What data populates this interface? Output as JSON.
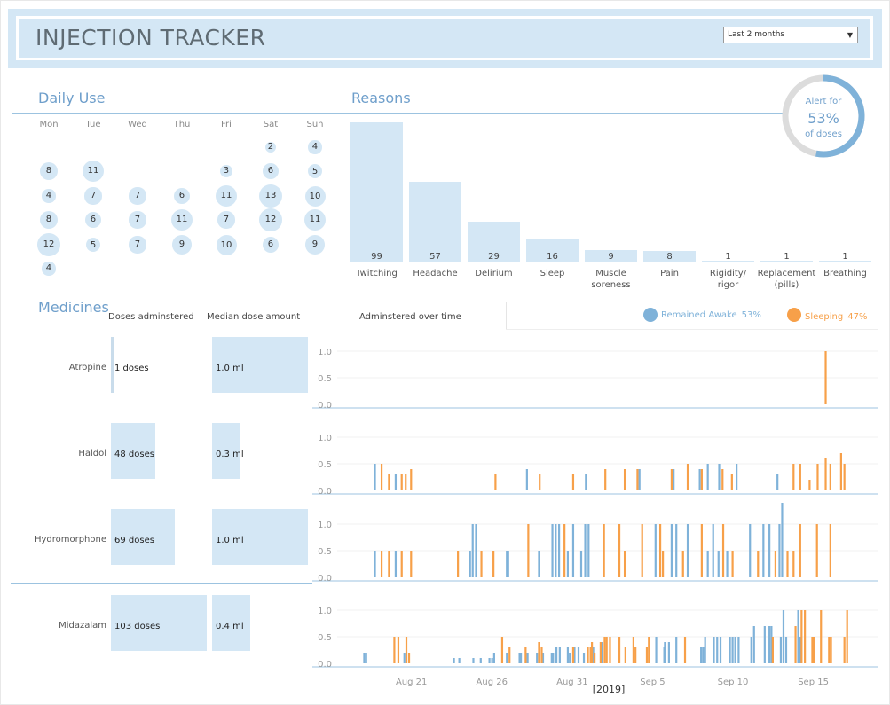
{
  "header": {
    "title": "INJECTION TRACKER",
    "date_filter": "Last 2 months"
  },
  "daily_use": {
    "title": "Daily Use",
    "days": [
      "Mon",
      "Tue",
      "Wed",
      "Thu",
      "Fri",
      "Sat",
      "Sun"
    ],
    "weeks": [
      [
        null,
        null,
        null,
        null,
        null,
        2,
        4
      ],
      [
        8,
        11,
        null,
        null,
        3,
        6,
        5
      ],
      [
        4,
        7,
        7,
        6,
        11,
        13,
        10
      ],
      [
        8,
        6,
        7,
        11,
        7,
        12,
        11
      ],
      [
        12,
        5,
        7,
        9,
        10,
        6,
        9
      ],
      [
        4,
        null,
        null,
        null,
        null,
        null,
        null
      ]
    ]
  },
  "reasons": {
    "title": "Reasons",
    "items": [
      {
        "label": "Twitching",
        "value": 99
      },
      {
        "label": "Headache",
        "value": 57
      },
      {
        "label": "Delirium",
        "value": 29
      },
      {
        "label": "Sleep",
        "value": 16
      },
      {
        "label": "Muscle soreness",
        "value": 9
      },
      {
        "label": "Pain",
        "value": 8
      },
      {
        "label": "Rigidity/ rigor",
        "value": 1
      },
      {
        "label": "Replacement (pills)",
        "value": 1
      },
      {
        "label": "Breathing",
        "value": 1
      }
    ]
  },
  "alert": {
    "line1": "Alert for",
    "value": "53%",
    "line2": "of doses",
    "fraction": 0.53,
    "colors": {
      "fill": "#7fb2d9",
      "rest": "#dcdcdc"
    }
  },
  "medicines": {
    "title": "Medicines",
    "col_doses": "Doses adminstered",
    "col_median": "Median dose amount",
    "col_time": "Adminstered over time",
    "legend": [
      {
        "label": "Remained Awake",
        "pct": "53%",
        "color": "#7fb2d9"
      },
      {
        "label": "Sleeping",
        "pct": "47%",
        "color": "#f7a049"
      }
    ],
    "rows": [
      {
        "name": "Atropine",
        "doses": 1,
        "doses_label": "1 doses",
        "median": 1.0,
        "median_label": "1.0 ml"
      },
      {
        "name": "Haldol",
        "doses": 48,
        "doses_label": "48 doses",
        "median": 0.3,
        "median_label": "0.3 ml"
      },
      {
        "name": "Hydromorphone",
        "doses": 69,
        "doses_label": "69 doses",
        "median": 1.0,
        "median_label": "1.0 ml"
      },
      {
        "name": "Midazalam",
        "doses": 103,
        "doses_label": "103 doses",
        "median": 0.4,
        "median_label": "0.4 ml"
      }
    ]
  },
  "chart_data": {
    "type": "bar",
    "xlabel": "[2019]",
    "xlim": [
      "2019-08-15T00",
      "2019-09-18T12"
    ],
    "x_ticks": [
      {
        "date": "2019-08-21",
        "label": "Aug 21"
      },
      {
        "date": "2019-08-26",
        "label": "Aug 26"
      },
      {
        "date": "2019-08-31",
        "label": "Aug 31"
      },
      {
        "date": "2019-09-05",
        "label": "Sep 5"
      },
      {
        "date": "2019-09-10",
        "label": "Sep 10"
      },
      {
        "date": "2019-09-15",
        "label": "Sep 15"
      }
    ],
    "y_ticks": [
      "1.0",
      "0.5",
      "0.0"
    ],
    "ylim": [
      0,
      1
    ],
    "panels": [
      {
        "name": "Atropine",
        "awake": [],
        "sleeping": [
          [
            "2019-09-15T17",
            1.0
          ]
        ]
      },
      {
        "name": "Haldol",
        "awake": [
          [
            "2019-08-18T16",
            0.5
          ],
          [
            "2019-08-19T23",
            0.3
          ],
          [
            "2019-08-28T03",
            0.4
          ],
          [
            "2019-08-31T19",
            0.3
          ],
          [
            "2019-09-04T03",
            0.4
          ],
          [
            "2019-09-06T06",
            0.4
          ],
          [
            "2019-09-07T21",
            0.4
          ],
          [
            "2019-09-08T09",
            0.5
          ],
          [
            "2019-09-09T02",
            0.5
          ],
          [
            "2019-09-10T04",
            0.5
          ],
          [
            "2019-09-12T17",
            0.3
          ]
        ],
        "sleeping": [
          [
            "2019-08-19T02",
            0.5
          ],
          [
            "2019-08-19T13",
            0.3
          ],
          [
            "2019-08-20T08",
            0.3
          ],
          [
            "2019-08-20T14",
            0.3
          ],
          [
            "2019-08-20T22",
            0.4
          ],
          [
            "2019-08-26T04",
            0.3
          ],
          [
            "2019-08-28T22",
            0.3
          ],
          [
            "2019-08-31T00",
            0.3
          ],
          [
            "2019-09-02T00",
            0.4
          ],
          [
            "2019-09-03T05",
            0.4
          ],
          [
            "2019-09-04T00",
            0.4
          ],
          [
            "2019-09-06T03",
            0.4
          ],
          [
            "2019-09-07T03",
            0.5
          ],
          [
            "2019-09-08T00",
            0.4
          ],
          [
            "2019-09-09T07",
            0.4
          ],
          [
            "2019-09-09T21",
            0.3
          ],
          [
            "2019-09-13T17",
            0.5
          ],
          [
            "2019-09-14T03",
            0.5
          ],
          [
            "2019-09-14T17",
            0.2
          ],
          [
            "2019-09-15T05",
            0.5
          ],
          [
            "2019-09-15T17",
            0.6
          ],
          [
            "2019-09-16T00",
            0.5
          ],
          [
            "2019-09-16T16",
            0.7
          ],
          [
            "2019-09-16T21",
            0.5
          ]
        ]
      },
      {
        "name": "Hydromorphone",
        "awake": [
          [
            "2019-08-18T16",
            0.5
          ],
          [
            "2019-08-19T23",
            0.5
          ],
          [
            "2019-08-24T14",
            0.5
          ],
          [
            "2019-08-24T18",
            1.0
          ],
          [
            "2019-08-24T23",
            1.0
          ],
          [
            "2019-08-26T21",
            0.5
          ],
          [
            "2019-08-26T23",
            0.5
          ],
          [
            "2019-08-28T21",
            0.5
          ],
          [
            "2019-08-29T17",
            1.0
          ],
          [
            "2019-08-29T22",
            1.0
          ],
          [
            "2019-08-30T03",
            1.0
          ],
          [
            "2019-08-30T16",
            0.5
          ],
          [
            "2019-08-31T00",
            1.0
          ],
          [
            "2019-08-31T12",
            0.5
          ],
          [
            "2019-08-31T18",
            1.0
          ],
          [
            "2019-08-31T23",
            1.0
          ],
          [
            "2019-09-05T03",
            1.0
          ],
          [
            "2019-09-06T03",
            1.0
          ],
          [
            "2019-09-06T10",
            1.0
          ],
          [
            "2019-09-07T03",
            1.0
          ],
          [
            "2019-09-08T09",
            0.5
          ],
          [
            "2019-09-08T17",
            1.0
          ],
          [
            "2019-09-09T01",
            0.5
          ],
          [
            "2019-09-09T14",
            0.5
          ],
          [
            "2019-09-11T00",
            1.0
          ],
          [
            "2019-09-11T20",
            1.0
          ],
          [
            "2019-09-12T05",
            1.0
          ],
          [
            "2019-09-12T20",
            1.0
          ],
          [
            "2019-09-13T00",
            1.4
          ]
        ],
        "sleeping": [
          [
            "2019-08-19T02",
            0.5
          ],
          [
            "2019-08-19T13",
            0.5
          ],
          [
            "2019-08-20T08",
            0.5
          ],
          [
            "2019-08-20T22",
            0.5
          ],
          [
            "2019-08-23T20",
            0.5
          ],
          [
            "2019-08-25T07",
            0.5
          ],
          [
            "2019-08-26T01",
            0.5
          ],
          [
            "2019-08-28T05",
            1.0
          ],
          [
            "2019-08-30T11",
            1.0
          ],
          [
            "2019-09-01T22",
            1.0
          ],
          [
            "2019-09-02T21",
            1.0
          ],
          [
            "2019-09-03T05",
            0.5
          ],
          [
            "2019-09-04T07",
            1.0
          ],
          [
            "2019-09-05T10",
            1.0
          ],
          [
            "2019-09-05T14",
            0.5
          ],
          [
            "2019-09-06T20",
            0.5
          ],
          [
            "2019-09-08T00",
            1.0
          ],
          [
            "2019-09-09T08",
            1.0
          ],
          [
            "2019-09-09T22",
            0.5
          ],
          [
            "2019-09-11T12",
            0.5
          ],
          [
            "2019-09-12T14",
            0.5
          ],
          [
            "2019-09-13T08",
            0.5
          ],
          [
            "2019-09-13T17",
            0.5
          ],
          [
            "2019-09-14T03",
            1.0
          ],
          [
            "2019-09-15T04",
            1.0
          ],
          [
            "2019-09-16T00",
            1.0
          ]
        ]
      },
      {
        "name": "Midazalam",
        "awake": [
          [
            "2019-08-18T00",
            0.2
          ],
          [
            "2019-08-18T03",
            0.2
          ],
          [
            "2019-08-20T12",
            0.2
          ],
          [
            "2019-08-23T14",
            0.1
          ],
          [
            "2019-08-23T22",
            0.1
          ],
          [
            "2019-08-24T19",
            0.1
          ],
          [
            "2019-08-25T06",
            0.1
          ],
          [
            "2019-08-25T19",
            0.1
          ],
          [
            "2019-08-25T23",
            0.1
          ],
          [
            "2019-08-26T02",
            0.2
          ],
          [
            "2019-08-26T21",
            0.2
          ],
          [
            "2019-08-27T16",
            0.2
          ],
          [
            "2019-08-27T18",
            0.2
          ],
          [
            "2019-08-28T04",
            0.2
          ],
          [
            "2019-08-28T18",
            0.2
          ],
          [
            "2019-08-29T03",
            0.2
          ],
          [
            "2019-08-29T16",
            0.2
          ],
          [
            "2019-08-29T18",
            0.2
          ],
          [
            "2019-08-29T23",
            0.3
          ],
          [
            "2019-08-30T04",
            0.3
          ],
          [
            "2019-08-30T16",
            0.3
          ],
          [
            "2019-08-30T19",
            0.2
          ],
          [
            "2019-08-31T02",
            0.3
          ],
          [
            "2019-08-31T08",
            0.3
          ],
          [
            "2019-08-31T16",
            0.2
          ],
          [
            "2019-09-01T06",
            0.3
          ],
          [
            "2019-09-01T19",
            0.4
          ],
          [
            "2019-09-05T04",
            0.5
          ],
          [
            "2019-09-05T16",
            0.3
          ],
          [
            "2019-09-05T17",
            0.4
          ],
          [
            "2019-09-05T23",
            0.4
          ],
          [
            "2019-09-06T10",
            0.5
          ],
          [
            "2019-09-07T23",
            0.3
          ],
          [
            "2019-09-08T02",
            0.3
          ],
          [
            "2019-09-08T05",
            0.5
          ],
          [
            "2019-09-08T18",
            0.5
          ],
          [
            "2019-09-08T23",
            0.5
          ],
          [
            "2019-09-09T04",
            0.5
          ],
          [
            "2019-09-09T18",
            0.5
          ],
          [
            "2019-09-09T22",
            0.5
          ],
          [
            "2019-09-10T02",
            0.5
          ],
          [
            "2019-09-10T07",
            0.5
          ],
          [
            "2019-09-11T02",
            0.5
          ],
          [
            "2019-09-11T06",
            0.7
          ],
          [
            "2019-09-11T22",
            0.7
          ],
          [
            "2019-09-12T05",
            0.7
          ],
          [
            "2019-09-12T08",
            0.7
          ],
          [
            "2019-09-12T22",
            0.5
          ],
          [
            "2019-09-13T02",
            1.0
          ],
          [
            "2019-09-13T06",
            0.5
          ],
          [
            "2019-09-14T00",
            1.0
          ],
          [
            "2019-09-14T03",
            0.5
          ]
        ],
        "sleeping": [
          [
            "2019-08-19T21",
            0.5
          ],
          [
            "2019-08-20T03",
            0.5
          ],
          [
            "2019-08-20T15",
            0.5
          ],
          [
            "2019-08-20T19",
            0.2
          ],
          [
            "2019-08-26T14",
            0.5
          ],
          [
            "2019-08-27T01",
            0.3
          ],
          [
            "2019-08-28T01",
            0.3
          ],
          [
            "2019-08-28T21",
            0.4
          ],
          [
            "2019-08-29T01",
            0.3
          ],
          [
            "2019-08-31T00",
            0.3
          ],
          [
            "2019-08-31T22",
            0.3
          ],
          [
            "2019-09-01T02",
            0.3
          ],
          [
            "2019-09-01T04",
            0.4
          ],
          [
            "2019-09-01T08",
            0.2
          ],
          [
            "2019-09-01T17",
            0.4
          ],
          [
            "2019-09-01T23",
            0.5
          ],
          [
            "2019-09-02T02",
            0.5
          ],
          [
            "2019-09-02T07",
            0.5
          ],
          [
            "2019-09-02T21",
            0.5
          ],
          [
            "2019-09-03T06",
            0.3
          ],
          [
            "2019-09-03T18",
            0.5
          ],
          [
            "2019-09-03T21",
            0.3
          ],
          [
            "2019-09-04T14",
            0.3
          ],
          [
            "2019-09-04T17",
            0.5
          ],
          [
            "2019-09-06T23",
            0.5
          ],
          [
            "2019-09-12T10",
            0.5
          ],
          [
            "2019-09-13T20",
            0.7
          ],
          [
            "2019-09-14T05",
            1.0
          ],
          [
            "2019-09-14T10",
            1.0
          ],
          [
            "2019-09-14T21",
            0.5
          ],
          [
            "2019-09-14T23",
            0.5
          ],
          [
            "2019-09-15T10",
            1.0
          ],
          [
            "2019-09-15T22",
            0.5
          ],
          [
            "2019-09-16T01",
            0.5
          ],
          [
            "2019-09-16T21",
            0.5
          ],
          [
            "2019-09-17T01",
            1.0
          ]
        ]
      }
    ]
  }
}
